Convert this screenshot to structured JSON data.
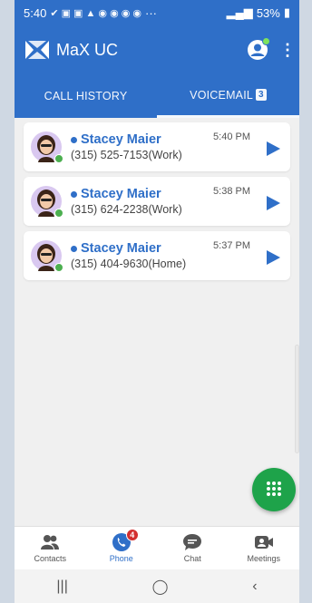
{
  "status_bar": {
    "time": "5:40",
    "battery": "53%",
    "overflow": "···"
  },
  "appbar": {
    "title": "MaX UC",
    "menu_icon": "more-vert-icon",
    "presence_icon": "account-presence-icon"
  },
  "tabs": [
    {
      "label": "CALL HISTORY",
      "active": false
    },
    {
      "label": "VOICEMAIL",
      "badge": "3",
      "active": true
    }
  ],
  "voicemails": [
    {
      "name": "Stacey Maier",
      "number": "(315) 525-7153(Work)",
      "time": "5:40 PM"
    },
    {
      "name": "Stacey Maier",
      "number": "(315) 624-2238(Work)",
      "time": "5:38 PM"
    },
    {
      "name": "Stacey Maier",
      "number": "(315) 404-9630(Home)",
      "time": "5:37 PM"
    }
  ],
  "bottom_nav": [
    {
      "label": "Contacts",
      "icon": "contacts-icon"
    },
    {
      "label": "Phone",
      "icon": "phone-icon",
      "badge": "4",
      "active": true
    },
    {
      "label": "Chat",
      "icon": "chat-icon"
    },
    {
      "label": "Meetings",
      "icon": "meetings-icon"
    }
  ],
  "colors": {
    "brand": "#2f6fc8",
    "fab": "#1ea34a",
    "badge": "#d32f2f",
    "online": "#4caf50"
  }
}
